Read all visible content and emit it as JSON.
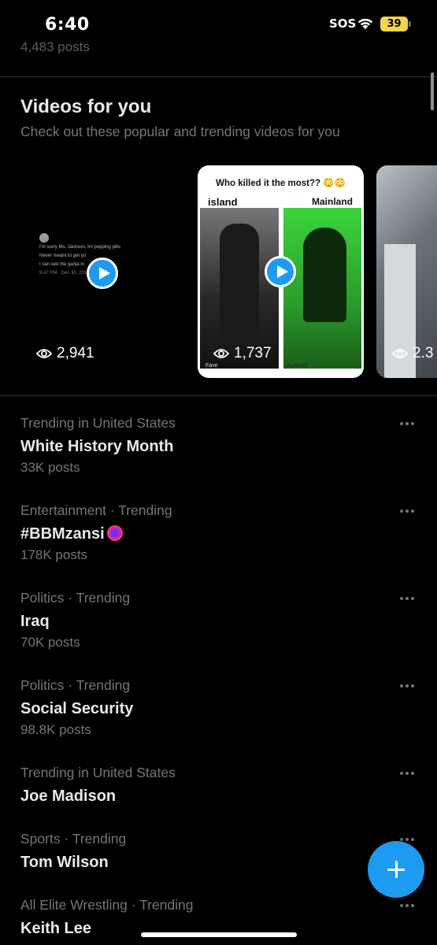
{
  "status_bar": {
    "time": "6:40",
    "sos": "SOS",
    "battery": "39"
  },
  "previous": {
    "count": "4,483 posts"
  },
  "videos_section": {
    "title": "Videos for you",
    "subtitle": "Check out these popular and trending videos for you",
    "cards": [
      {
        "views": "2,941",
        "tweet_lines": [
          "I'm sorry Ms. Jackson, Im popping pills",
          "Never meant to get yo",
          "I can see the ganja in",
          "9:47 PM · Dec 30, 2016"
        ]
      },
      {
        "views": "1,737",
        "title": "Who killed it the most?? 😳😳",
        "left_label": "island",
        "right_label": "Mainland",
        "left_tag": "Fave",
        "right_tag": "Ayomaff"
      },
      {
        "views": "2.3"
      }
    ]
  },
  "trends": [
    {
      "meta": "Trending in United States",
      "name": "White History Month",
      "count": "33K posts"
    },
    {
      "meta": "Entertainment · Trending",
      "name": "#BBMzansi",
      "count": "178K posts"
    },
    {
      "meta": "Politics · Trending",
      "name": "Iraq",
      "count": "70K posts"
    },
    {
      "meta": "Politics · Trending",
      "name": "Social Security",
      "count": "98.8K posts"
    },
    {
      "meta": "Trending in United States",
      "name": "Joe Madison",
      "count": ""
    },
    {
      "meta": "Sports · Trending",
      "name": "Tom Wilson",
      "count": ""
    },
    {
      "meta": "All Elite Wrestling · Trending",
      "name": "Keith Lee",
      "count": ""
    }
  ],
  "colors": {
    "accent": "#1d9bf0",
    "background": "#000000",
    "secondary_text": "#71767b"
  },
  "icons": {
    "fab": "plus-icon",
    "views": "eye-icon",
    "more": "more-horizontal-icon"
  }
}
